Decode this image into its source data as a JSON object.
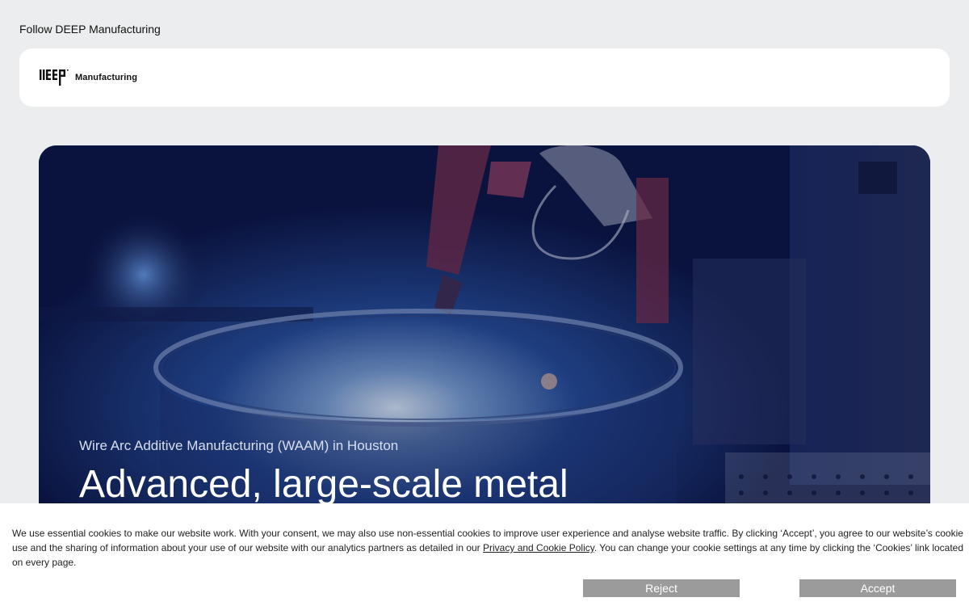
{
  "header": {
    "follow_text": "Follow DEEP Manufacturing",
    "logo_text": "Manufacturing"
  },
  "hero": {
    "subtitle": "Wire Arc Additive Manufacturing (WAAM) in Houston",
    "title": "Advanced, large-scale metal"
  },
  "cookie_banner": {
    "text_before_link": "We use essential cookies to make our website work. With your consent, we may also use non-essential cookies to improve user experience and analyse website traffic. By clicking ‘Accept’, you agree to our website’s cookie use and the sharing of information about your use of our website with our analytics partners as detailed in our ",
    "link_text": "Privacy and Cookie Policy",
    "text_after_link": ". You can change your cookie settings at any time by clicking the ‘Cookies’ link located on every page.",
    "reject_label": "Reject",
    "accept_label": "Accept"
  },
  "colors": {
    "page_background": "#ecedee",
    "hero_dark_blue": "#0d1740",
    "button_gray": "#9b9b9b"
  }
}
